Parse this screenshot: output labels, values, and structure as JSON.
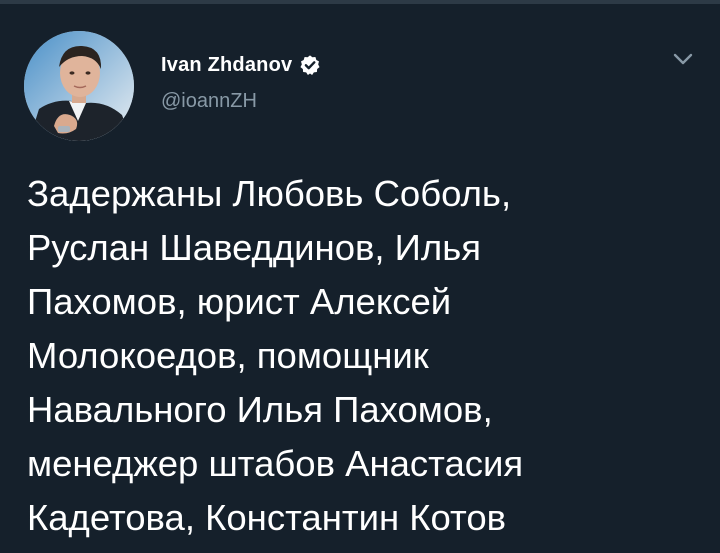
{
  "author": {
    "display_name": "Ivan Zhdanov",
    "handle": "@ioannZH",
    "verified": true
  },
  "icons": {
    "verified": "verified-badge-icon",
    "menu": "chevron-down-icon",
    "avatar": "avatar"
  },
  "colors": {
    "background": "#15202b",
    "text_primary": "#ffffff",
    "text_secondary": "#8899a6"
  },
  "tweet": {
    "lines": [
      "Задержаны Любовь Соболь,",
      "Руслан Шаведдинов, Илья",
      "Пахомов, юрист Алексей",
      "Молокоедов, помощник",
      "Навального Илья Пахомов,",
      "менеджер штабов Анастасия",
      "Кадетова, Константин Котов"
    ]
  }
}
